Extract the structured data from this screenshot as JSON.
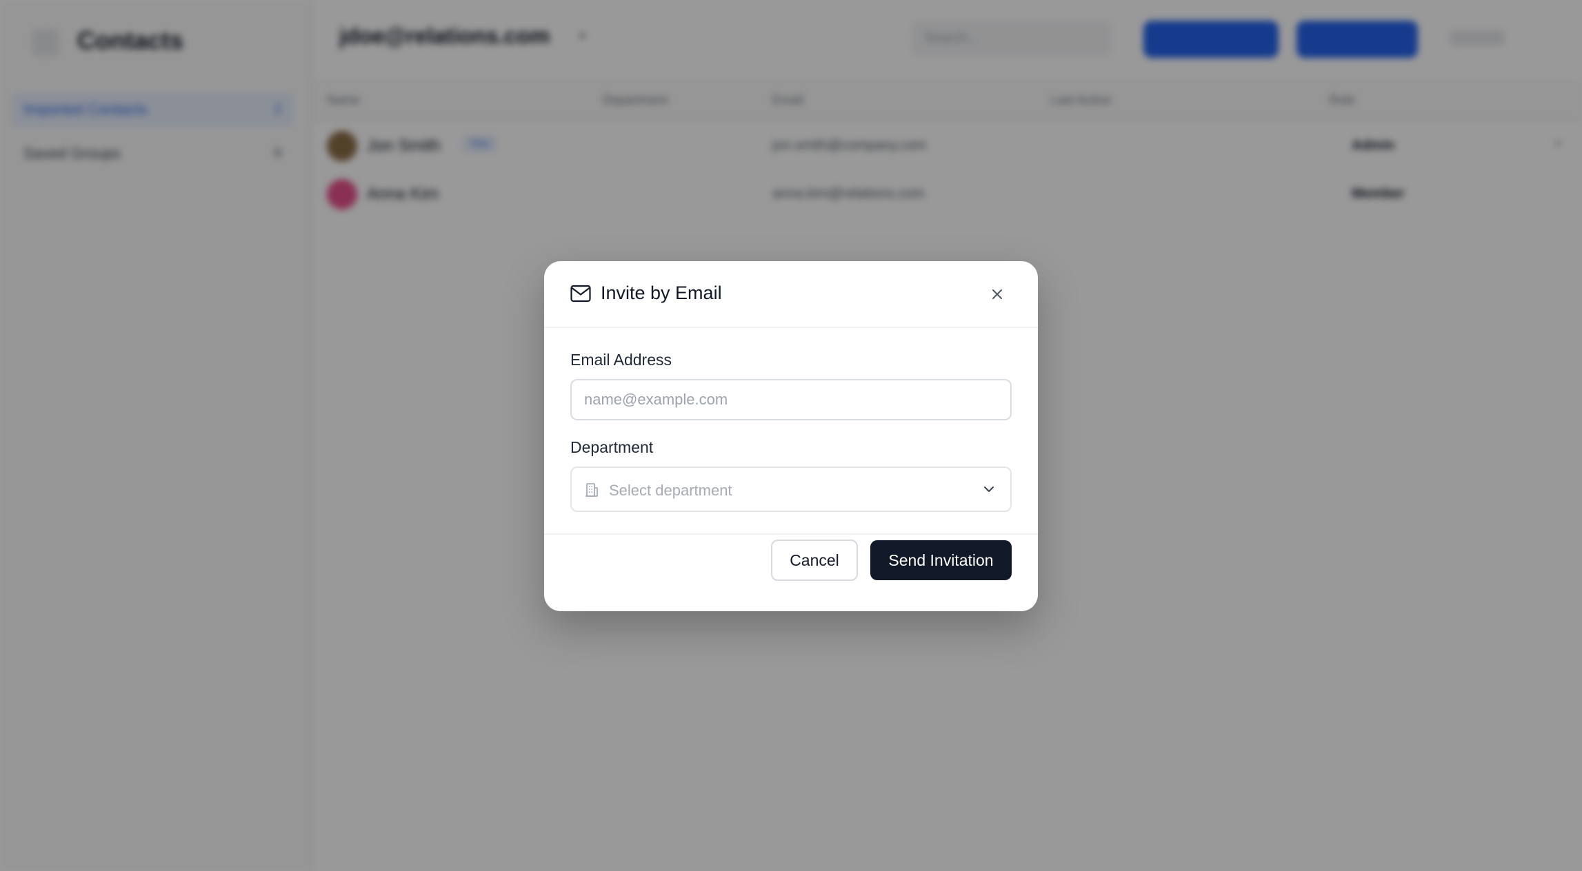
{
  "background": {
    "sidebar": {
      "title": "Contacts",
      "items": [
        {
          "label": "Imported Contacts",
          "count": "2"
        },
        {
          "label": "Saved Groups",
          "count": "0"
        }
      ]
    },
    "header": {
      "account": "jdoe@relations.com",
      "search_placeholder": "Search..."
    },
    "table": {
      "columns": [
        "Name",
        "Department",
        "Email",
        "Last Active",
        "Role"
      ],
      "rows": [
        {
          "name": "Jon Smith",
          "badge": "You",
          "email": "jon.smith@company.com",
          "role": "Admin"
        },
        {
          "name": "Anna Kim",
          "email": "anna.kim@relations.com",
          "role": "Member"
        }
      ]
    }
  },
  "modal": {
    "title": "Invite by Email",
    "email_label": "Email Address",
    "email_placeholder": "name@example.com",
    "email_value": "",
    "department_label": "Department",
    "department_placeholder": "Select department",
    "cancel_label": "Cancel",
    "send_label": "Send Invitation",
    "icons": {
      "title": "mail-icon",
      "close": "close-icon",
      "department": "building-icon",
      "select": "chevron-down-icon"
    }
  }
}
